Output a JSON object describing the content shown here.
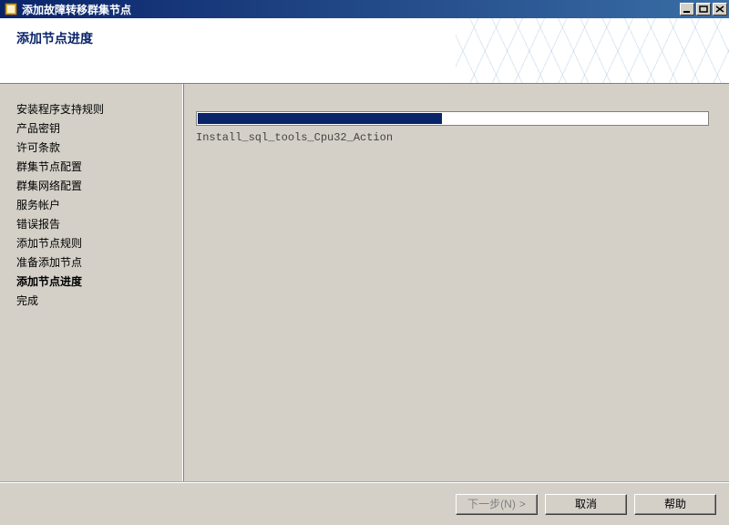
{
  "window": {
    "title": "添加故障转移群集节点"
  },
  "header": {
    "title": "添加节点进度"
  },
  "sidebar": {
    "items": [
      {
        "label": "安装程序支持规则",
        "current": false
      },
      {
        "label": "产品密钥",
        "current": false
      },
      {
        "label": "许可条款",
        "current": false
      },
      {
        "label": "群集节点配置",
        "current": false
      },
      {
        "label": "群集网络配置",
        "current": false
      },
      {
        "label": "服务帐户",
        "current": false
      },
      {
        "label": "错误报告",
        "current": false
      },
      {
        "label": "添加节点规则",
        "current": false
      },
      {
        "label": "准备添加节点",
        "current": false
      },
      {
        "label": "添加节点进度",
        "current": true
      },
      {
        "label": "完成",
        "current": false
      }
    ]
  },
  "progress": {
    "percent": 48,
    "status_text": "Install_sql_tools_Cpu32_Action"
  },
  "footer": {
    "next_label": "下一步(N)",
    "next_chevron": ">",
    "cancel_label": "取消",
    "help_label": "帮助"
  }
}
